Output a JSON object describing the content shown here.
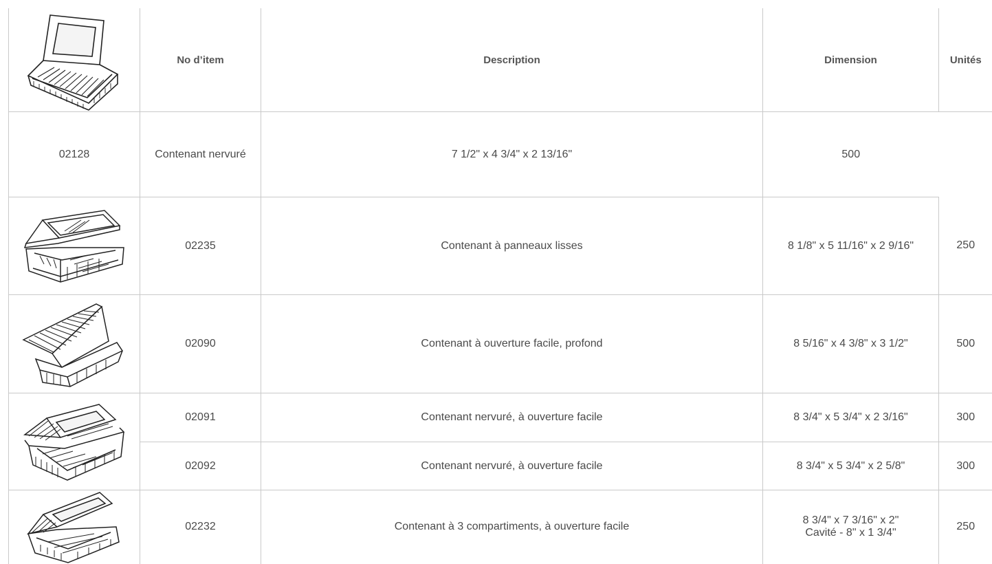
{
  "table": {
    "headers": {
      "item": "No d’item",
      "description": "Description",
      "dimension": "Dimension",
      "units": "Unités"
    },
    "rows": [
      {
        "item": "02128",
        "description": "Contenant nervuré",
        "dimension": "7 1/2\" x 4 3/4\" x 2 13/16\"",
        "units": "500",
        "image": "ribbed-container-window-lid"
      },
      {
        "item": "02235",
        "description": "Contenant à panneaux lisses",
        "dimension": "8 1/8\" x 5 11/16\" x 2 9/16\"",
        "units": "250",
        "image": "smooth-panel-container"
      },
      {
        "item": "02090",
        "description": "Contenant à ouverture facile, profond",
        "dimension": "8 5/16\" x 4 3/8\" x 3 1/2\"",
        "units": "500",
        "image": "deep-easy-open-container"
      },
      {
        "item": "02091",
        "description": "Contenant nervuré, à ouverture facile",
        "dimension": "8 3/4\" x 5 3/4\" x 2 3/16\"",
        "units": "300",
        "image": "ribbed-easy-open-container"
      },
      {
        "item": "02092",
        "description": "Contenant nervuré, à ouverture facile",
        "dimension": "8 3/4\" x 5 3/4\" x 2 5/8\"",
        "units": "300"
      },
      {
        "item": "02232",
        "description": "Contenant à 3 compartiments, à ouverture facile",
        "dimension": "8 3/4\" x 7 3/16\" x 2\"",
        "dimension_line2": "Cavité - 8\" x 1 3/4\"",
        "units": "250",
        "image": "three-compartment-container"
      }
    ]
  }
}
